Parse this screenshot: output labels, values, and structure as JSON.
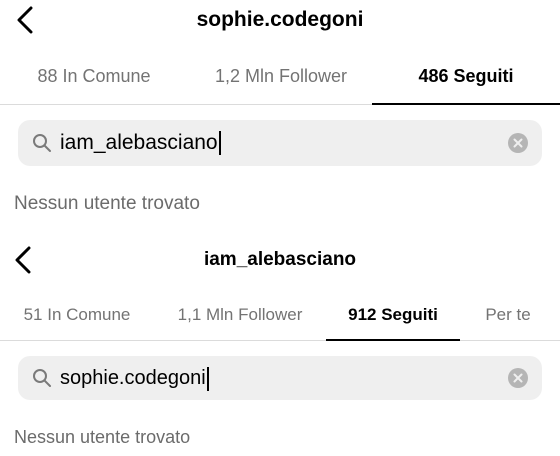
{
  "top": {
    "title": "sophie.codegoni",
    "tabs": [
      {
        "label": "88 In Comune",
        "active": false
      },
      {
        "label": "1,2 Mln Follower",
        "active": false
      },
      {
        "label": "486 Seguiti",
        "active": true
      }
    ],
    "search": {
      "value": "iam_alebasciano"
    },
    "empty_message": "Nessun utente trovato"
  },
  "bottom": {
    "title": "iam_alebasciano",
    "tabs": [
      {
        "label": "51 In Comune",
        "active": false
      },
      {
        "label": "1,1 Mln Follower",
        "active": false
      },
      {
        "label": "912 Seguiti",
        "active": true
      },
      {
        "label": "Per te",
        "active": false
      }
    ],
    "search": {
      "value": "sophie.codegoni"
    },
    "empty_message": "Nessun utente trovato"
  },
  "icons": {
    "back": "chevron-left-icon",
    "search": "search-icon",
    "clear": "clear-icon"
  },
  "colors": {
    "tab_inactive": "#737373",
    "tab_active": "#000000",
    "search_bg": "#efefef",
    "empty_text": "#6b6b6b"
  }
}
